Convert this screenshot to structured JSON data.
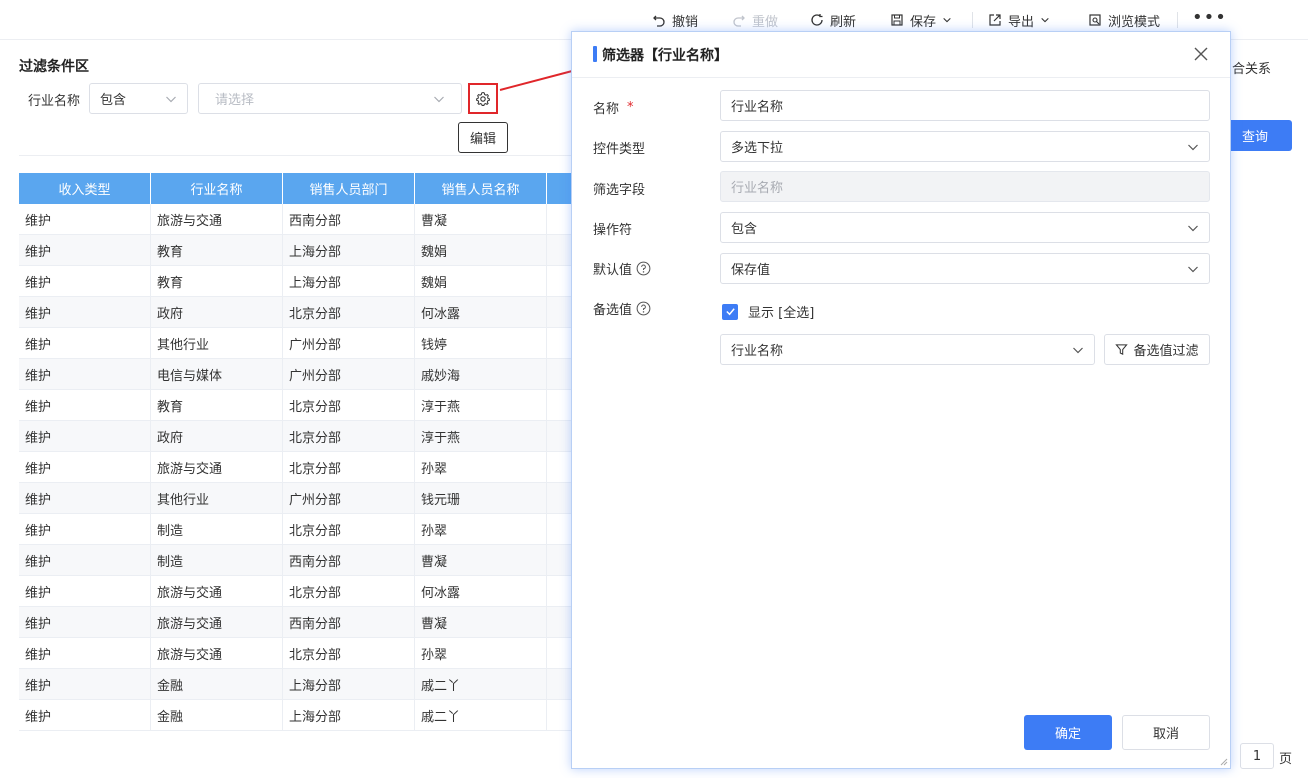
{
  "toolbar": {
    "undo": "撤销",
    "redo": "重做",
    "refresh": "刷新",
    "save": "保存",
    "export": "导出",
    "browse": "浏览模式",
    "more": "•••"
  },
  "filter": {
    "title": "过滤条件区",
    "field_label": "行业名称",
    "operator": "包含",
    "value_placeholder": "请选择",
    "tooltip": "编辑",
    "right_text": "合关系",
    "query": "查询"
  },
  "table": {
    "headers": [
      "收入类型",
      "行业名称",
      "销售人员部门",
      "销售人员名称"
    ],
    "rows": [
      [
        "维护",
        "旅游与交通",
        "西南分部",
        "曹凝"
      ],
      [
        "维护",
        "教育",
        "上海分部",
        "魏娟"
      ],
      [
        "维护",
        "教育",
        "上海分部",
        "魏娟"
      ],
      [
        "维护",
        "政府",
        "北京分部",
        "何冰露"
      ],
      [
        "维护",
        "其他行业",
        "广州分部",
        "钱婷"
      ],
      [
        "维护",
        "电信与媒体",
        "广州分部",
        "戚妙海"
      ],
      [
        "维护",
        "教育",
        "北京分部",
        "淳于燕"
      ],
      [
        "维护",
        "政府",
        "北京分部",
        "淳于燕"
      ],
      [
        "维护",
        "旅游与交通",
        "北京分部",
        "孙翠"
      ],
      [
        "维护",
        "其他行业",
        "广州分部",
        "钱元珊"
      ],
      [
        "维护",
        "制造",
        "北京分部",
        "孙翠"
      ],
      [
        "维护",
        "制造",
        "西南分部",
        "曹凝"
      ],
      [
        "维护",
        "旅游与交通",
        "北京分部",
        "何冰露"
      ],
      [
        "维护",
        "旅游与交通",
        "西南分部",
        "曹凝"
      ],
      [
        "维护",
        "旅游与交通",
        "北京分部",
        "孙翠"
      ],
      [
        "维护",
        "金融",
        "上海分部",
        "戚二丫"
      ],
      [
        "维护",
        "金融",
        "上海分部",
        "戚二丫"
      ]
    ]
  },
  "pager": {
    "page": "1",
    "unit": "页"
  },
  "dialog": {
    "title": "筛选器【行业名称】",
    "name_label": "名称",
    "name_value": "行业名称",
    "control_label": "控件类型",
    "control_value": "多选下拉",
    "field_label": "筛选字段",
    "field_value": "行业名称",
    "operator_label": "操作符",
    "operator_value": "包含",
    "default_label": "默认值",
    "default_value": "保存值",
    "options_label": "备选值",
    "show_all": "显示 [全选]",
    "options_value": "行业名称",
    "options_filter": "备选值过滤",
    "ok": "确定",
    "cancel": "取消"
  },
  "colors": {
    "accent": "#3d7cf5",
    "table_header": "#5aa6ef",
    "highlight": "#e0262a"
  }
}
